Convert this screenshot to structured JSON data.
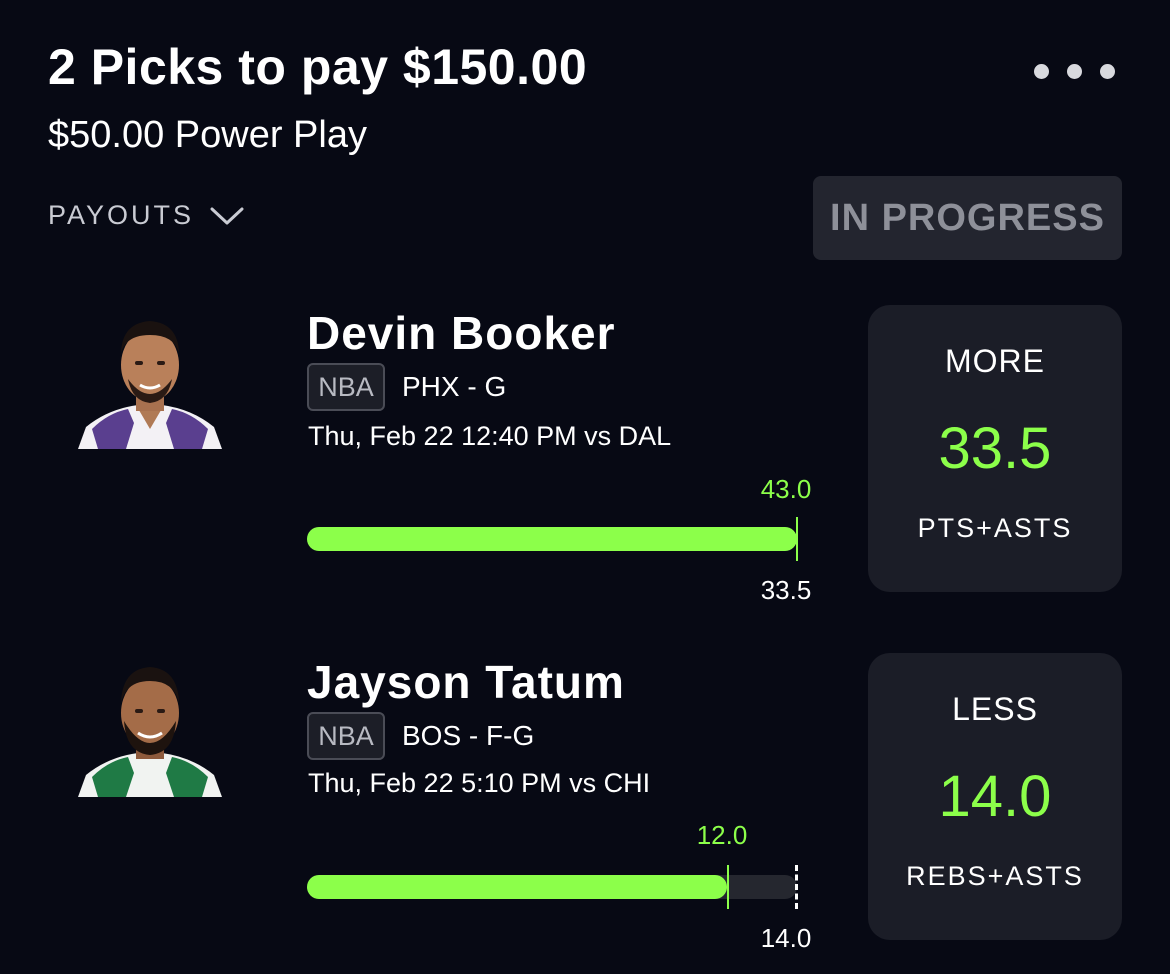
{
  "header": {
    "title": "2 Picks to pay $150.00",
    "subtitle": "$50.00 Power Play",
    "more_icon": "more-horizontal-icon",
    "payouts_label": "PAYOUTS",
    "payouts_icon": "chevron-down-icon",
    "status": "IN PROGRESS"
  },
  "colors": {
    "background": "#070914",
    "accent": "#8cff4a",
    "card": "#1b1d27",
    "badge": "#23252f"
  },
  "picks": [
    {
      "player": "Devin Booker",
      "league": "NBA",
      "team_position": "PHX - G",
      "game": "Thu, Feb 22 12:40 PM  vs DAL",
      "current": "43.0",
      "line_label": "33.5",
      "progress_fraction": 1.0,
      "line_fraction": 1.0,
      "direction": "MORE",
      "line": "33.5",
      "stat": "PTS+ASTS"
    },
    {
      "player": "Jayson Tatum",
      "league": "NBA",
      "team_position": "BOS - F-G",
      "game": "Thu, Feb 22 5:10 PM  vs CHI",
      "current": "12.0",
      "line_label": "14.0",
      "progress_fraction": 0.857,
      "line_fraction": 1.0,
      "direction": "LESS",
      "line": "14.0",
      "stat": "REBS+ASTS"
    }
  ]
}
